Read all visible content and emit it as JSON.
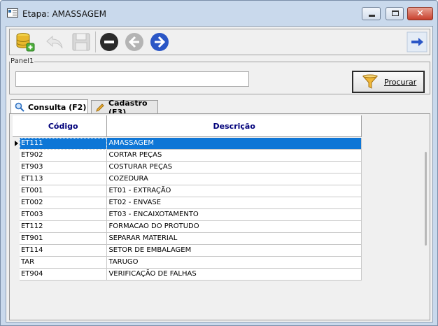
{
  "window": {
    "title": "Etapa: AMASSAGEM",
    "close_glyph": "✕"
  },
  "toolbar": {
    "buttons": [
      {
        "icon": "database-add-icon"
      },
      {
        "icon": "undo-icon"
      },
      {
        "icon": "save-icon"
      },
      {
        "icon": "delete-icon"
      },
      {
        "icon": "back-arrow-icon"
      },
      {
        "icon": "forward-arrow-icon"
      },
      {
        "icon": "exit-arrow-icon"
      }
    ]
  },
  "panel": {
    "legend": "Panel1",
    "search_value": "",
    "procurar_label": "Procurar"
  },
  "tabs": [
    {
      "label": "Consulta (F2)",
      "active": true
    },
    {
      "label": "Cadastro (F3)",
      "active": false
    }
  ],
  "grid": {
    "columns": [
      "Código",
      "Descrição"
    ],
    "rows": [
      {
        "codigo": "ET111",
        "descricao": "AMASSAGEM"
      },
      {
        "codigo": "ET902",
        "descricao": "CORTAR PEÇAS"
      },
      {
        "codigo": "ET903",
        "descricao": "COSTURAR PEÇAS"
      },
      {
        "codigo": "ET113",
        "descricao": "COZEDURA"
      },
      {
        "codigo": "ET001",
        "descricao": "ET01 - EXTRAÇÃO"
      },
      {
        "codigo": "ET002",
        "descricao": "ET02 - ENVASE"
      },
      {
        "codigo": "ET003",
        "descricao": "ET03 - ENCAIXOTAMENTO"
      },
      {
        "codigo": "ET112",
        "descricao": "FORMACAO DO PROTUDO"
      },
      {
        "codigo": "ET901",
        "descricao": "SEPARAR MATERIAL"
      },
      {
        "codigo": "ET114",
        "descricao": "SETOR DE EMBALAGEM"
      },
      {
        "codigo": "TAR",
        "descricao": "TARUGO"
      },
      {
        "codigo": "ET904",
        "descricao": "VERIFICAÇÃO DE FALHAS"
      }
    ],
    "selected_index": 0
  },
  "colors": {
    "selection": "#0e76d6",
    "header_text": "#00007a",
    "nav_blue": "#2a56c6"
  }
}
